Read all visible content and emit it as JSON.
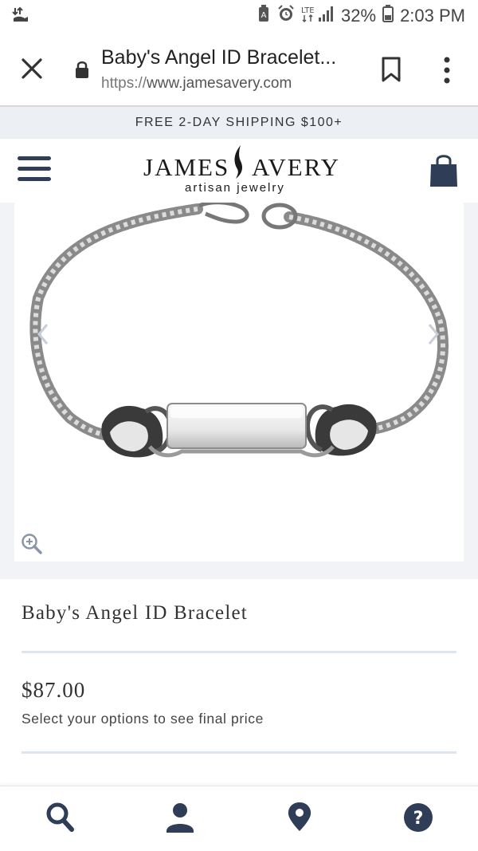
{
  "status_bar": {
    "battery_percent": "32%",
    "time": "2:03 PM",
    "network": "LTE"
  },
  "browser": {
    "page_title": "Baby's Angel ID Bracelet...",
    "url_scheme": "https://",
    "url_host": "www.jamesavery.com"
  },
  "banner": {
    "text": "FREE 2-DAY SHIPPING $100+"
  },
  "header": {
    "logo_word_1": "JAMES",
    "logo_word_2": "AVERY",
    "logo_tagline": "artisan jewelry"
  },
  "product": {
    "name": "Baby's Angel ID Bracelet",
    "price": "$87.00",
    "price_note": "Select your options to see final price"
  },
  "bottom_nav": {
    "items": [
      "search-icon",
      "account-icon",
      "location-icon",
      "help-icon"
    ]
  },
  "colors": {
    "brand_navy": "#2f3e56",
    "banner_bg": "#eceff4",
    "divider": "#dfe5ee"
  }
}
